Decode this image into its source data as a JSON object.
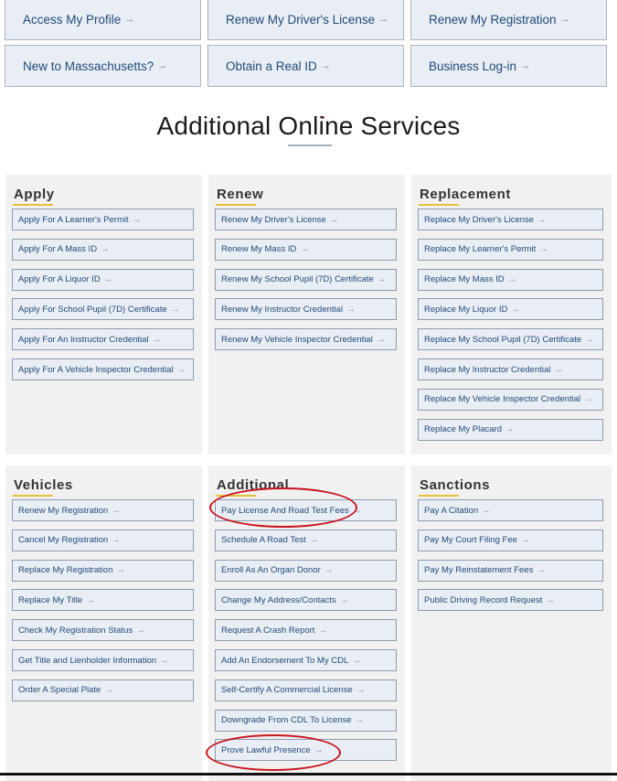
{
  "top_links": [
    {
      "label": "Access My Profile",
      "icon": "arrow-right-icon"
    },
    {
      "label": "Renew My Driver's License",
      "icon": "arrow-right-icon"
    },
    {
      "label": "Renew My Registration",
      "icon": "arrow-right-icon"
    },
    {
      "label": "New to Massachusetts?",
      "icon": "arrow-right-icon"
    },
    {
      "label": "Obtain a Real ID",
      "icon": "arrow-right-icon"
    },
    {
      "label": "Business Log-in",
      "icon": "arrow-right-icon"
    }
  ],
  "arrow_glyph": "→",
  "section_title": "Additional Online Services",
  "panels": [
    {
      "heading": "Apply",
      "items": [
        "Apply For A Learner's Permit",
        "Apply For A Mass ID",
        "Apply For A Liquor ID",
        "Apply For School Pupil (7D) Certificate",
        "Apply For An Instructor Credential",
        "Apply For A Vehicle Inspector Credential"
      ]
    },
    {
      "heading": "Renew",
      "items": [
        "Renew My Driver's License",
        "Renew My Mass ID",
        "Renew My School Pupil (7D) Certificate",
        "Renew My Instructor Credential",
        "Renew My Vehicle Inspector Credential"
      ]
    },
    {
      "heading": "Replacement",
      "items": [
        "Replace My Driver's License",
        "Replace My Learner's Permit",
        "Replace My Mass ID",
        "Replace My Liquor ID",
        "Replace My School Pupil (7D) Certificate",
        "Replace My Instructor Credential",
        "Replace My Vehicle Inspector Credential",
        "Replace My Placard"
      ]
    },
    {
      "heading": "Vehicles",
      "items": [
        "Renew My Registration",
        "Cancel My Registration",
        "Replace My Registration",
        "Replace My Title",
        "Check My Registration Status",
        "Get Title and Lienholder Information",
        "Order A Special Plate"
      ]
    },
    {
      "heading": "Additional",
      "items": [
        "Pay License And Road Test Fees",
        "Schedule A Road Test",
        "Enroll As An Organ Donor",
        "Change My Address/Contacts",
        "Request A Crash Report",
        "Add An Endorsement To My CDL",
        "Self-Certify A Commercial License",
        "Downgrade From CDL To License",
        "Prove Lawful Presence"
      ]
    },
    {
      "heading": "Sanctions",
      "items": [
        "Pay A Citation",
        "Pay My Court Filing Fee",
        "Pay My Reinstatement Fees",
        "Public Driving Record Request"
      ]
    }
  ],
  "annotations": [
    {
      "target": "Pay License And Road Test Fees",
      "color": "#c8141e"
    },
    {
      "target": "Prove Lawful Presence",
      "color": "#c8141e"
    }
  ]
}
